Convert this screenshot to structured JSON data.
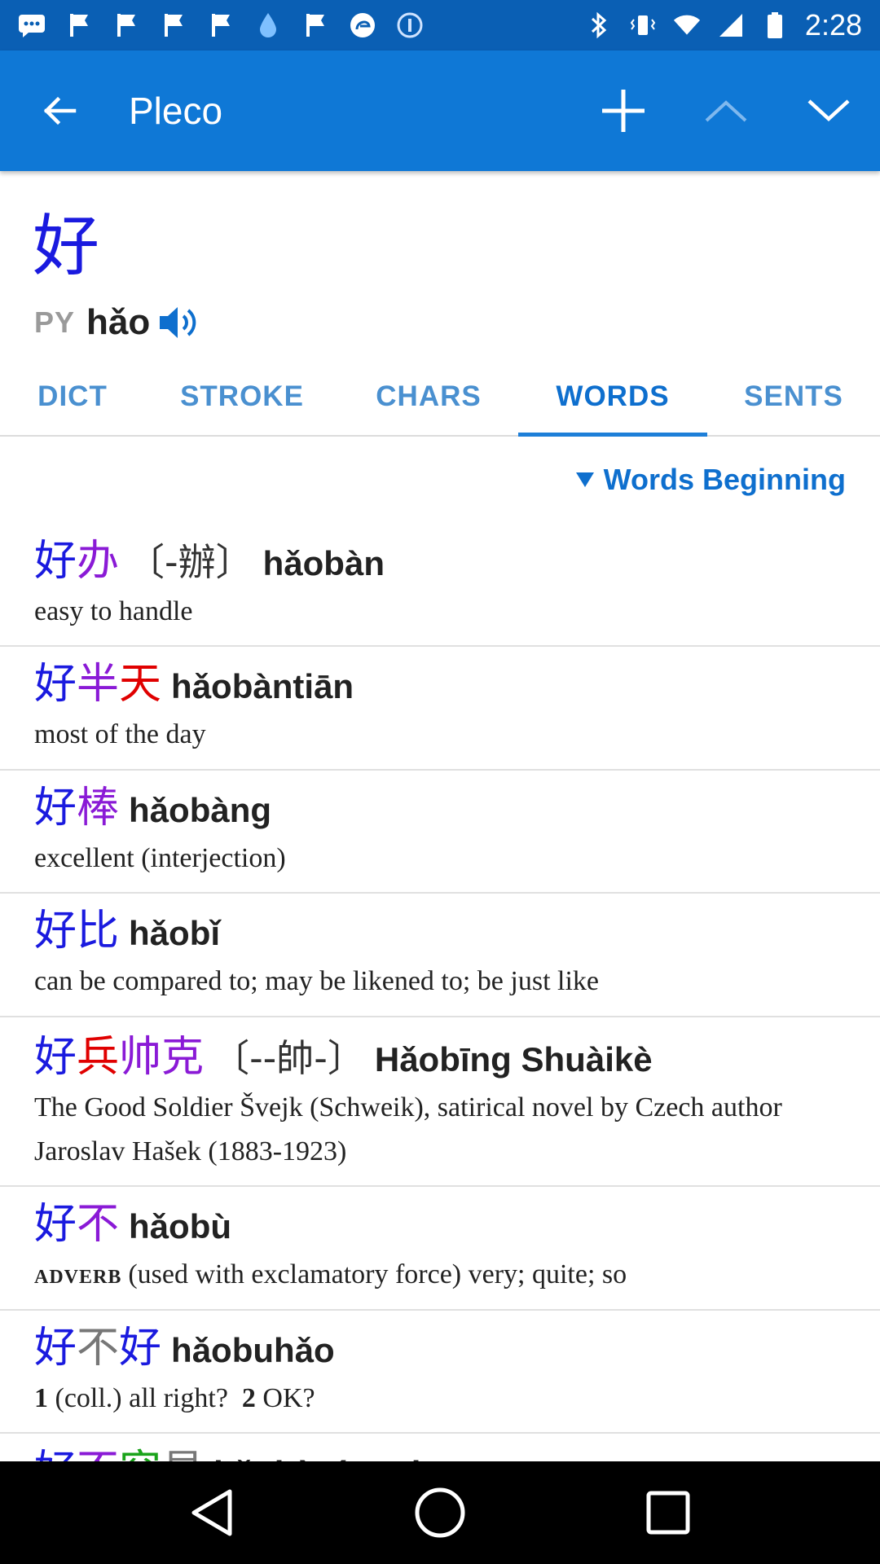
{
  "status_bar": {
    "time": "2:28",
    "icons_left": [
      "message-icon",
      "flag-icon",
      "flag-icon",
      "flag-icon",
      "flag-icon",
      "drop-icon",
      "flag-icon",
      "edge-icon",
      "coin-icon"
    ],
    "icons_right": [
      "bluetooth-icon",
      "vibrate-icon",
      "wifi-icon",
      "signal-icon",
      "battery-icon"
    ]
  },
  "appbar": {
    "title": "Pleco"
  },
  "header": {
    "headword": "好",
    "py_tag": "PY",
    "pinyin": "hǎo"
  },
  "tabs": [
    "DICT",
    "STROKE",
    "CHARS",
    "WORDS",
    "SENTS"
  ],
  "active_tab": "WORDS",
  "filter": {
    "label": "Words Beginning"
  },
  "colors": {
    "statusbar": "#0a5fb4",
    "appbar": "#0f78d6",
    "tone1": "#e00000",
    "tone2": "#1aa31a",
    "tone3": "#1a1adf",
    "tone4": "#8a1ad6",
    "tone5": "#777777"
  },
  "entries": [
    {
      "chars": [
        {
          "c": "好",
          "tone": 3
        },
        {
          "c": "办",
          "tone": 4
        }
      ],
      "trad": "〔-辦〕",
      "pinyin": "hǎobàn",
      "def": "easy to handle"
    },
    {
      "chars": [
        {
          "c": "好",
          "tone": 3
        },
        {
          "c": "半",
          "tone": 4
        },
        {
          "c": "天",
          "tone": 1
        }
      ],
      "trad": "",
      "pinyin": "hǎobàntiān",
      "def": "most of the day"
    },
    {
      "chars": [
        {
          "c": "好",
          "tone": 3
        },
        {
          "c": "棒",
          "tone": 4
        }
      ],
      "trad": "",
      "pinyin": "hǎobàng",
      "def": "excellent (interjection)"
    },
    {
      "chars": [
        {
          "c": "好",
          "tone": 3
        },
        {
          "c": "比",
          "tone": 3
        }
      ],
      "trad": "",
      "pinyin": "hǎobǐ",
      "def": "can be compared to; may be likened to; be just like"
    },
    {
      "chars": [
        {
          "c": "好",
          "tone": 3
        },
        {
          "c": "兵",
          "tone": 1
        },
        {
          "c": "帅",
          "tone": 4
        },
        {
          "c": "克",
          "tone": 4
        }
      ],
      "trad": "〔--帥-〕",
      "pinyin": "Hǎobīng Shuàikè",
      "def": "The Good Soldier Švejk (Schweik), satirical novel by Czech author Jaroslav Hašek (1883-1923)"
    },
    {
      "chars": [
        {
          "c": "好",
          "tone": 3
        },
        {
          "c": "不",
          "tone": 4
        }
      ],
      "trad": "",
      "pinyin": "hǎobù",
      "pos": "adverb",
      "def": "(used with exclamatory force) very; quite; so"
    },
    {
      "chars": [
        {
          "c": "好",
          "tone": 3
        },
        {
          "c": "不",
          "tone": 5
        },
        {
          "c": "好",
          "tone": 3
        }
      ],
      "trad": "",
      "pinyin": "hǎobuhǎo",
      "num1": "1",
      "def1": "(coll.) all right?",
      "num2": "2",
      "def2": "OK?"
    },
    {
      "chars": [
        {
          "c": "好",
          "tone": 3
        },
        {
          "c": "不",
          "tone": 4
        },
        {
          "c": "容",
          "tone": 2
        },
        {
          "c": "易",
          "tone": 5
        }
      ],
      "trad": "",
      "pinyin": "hǎobùróngyi",
      "def": ""
    }
  ]
}
